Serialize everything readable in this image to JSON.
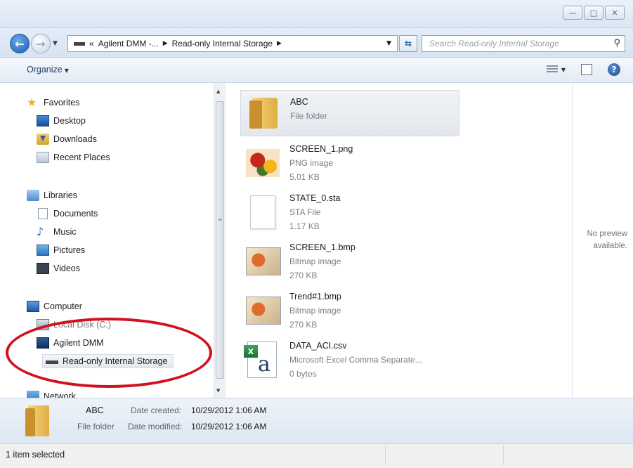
{
  "window": {
    "caption_buttons": [
      "minimize",
      "maximize",
      "close"
    ],
    "accent": "#d0121e"
  },
  "address": {
    "prefix": "«",
    "crumbs": [
      "Agilent DMM -...",
      "Read-only Internal Storage"
    ],
    "search_placeholder": "Search Read-only Internal Storage"
  },
  "toolbar": {
    "organize_label": "Organize"
  },
  "nav": {
    "favorites": {
      "label": "Favorites",
      "items": [
        "Desktop",
        "Downloads",
        "Recent Places"
      ]
    },
    "libraries": {
      "label": "Libraries",
      "items": [
        "Documents",
        "Music",
        "Pictures",
        "Videos"
      ]
    },
    "computer": {
      "label": "Computer",
      "items": [
        "Local Disk (C:)",
        "Agilent DMM",
        "Read-only Internal Storage"
      ]
    },
    "network": {
      "label": "Network"
    }
  },
  "files": [
    {
      "name": "ABC",
      "type": "File folder",
      "size": "",
      "icon": "folder-icon"
    },
    {
      "name": "SCREEN_1.png",
      "type": "PNG image",
      "size": "5.01 KB",
      "icon": "png-image-icon"
    },
    {
      "name": "STATE_0.sta",
      "type": "STA File",
      "size": "1.17 KB",
      "icon": "blank-file-icon"
    },
    {
      "name": "SCREEN_1.bmp",
      "type": "Bitmap image",
      "size": "270 KB",
      "icon": "bitmap-image-icon"
    },
    {
      "name": "Trend#1.bmp",
      "type": "Bitmap image",
      "size": "270 KB",
      "icon": "bitmap-image-icon"
    },
    {
      "name": "DATA_ACI.csv",
      "type": "Microsoft Excel Comma Separate...",
      "size": "0 bytes",
      "icon": "excel-csv-icon"
    }
  ],
  "preview": {
    "line1": "No preview",
    "line2": "available."
  },
  "details": {
    "name": "ABC",
    "type": "File folder",
    "created_label": "Date created:",
    "created_value": "10/29/2012 1:06 AM",
    "modified_label": "Date modified:",
    "modified_value": "10/29/2012 1:06 AM"
  },
  "status": {
    "text": "1 item selected"
  }
}
